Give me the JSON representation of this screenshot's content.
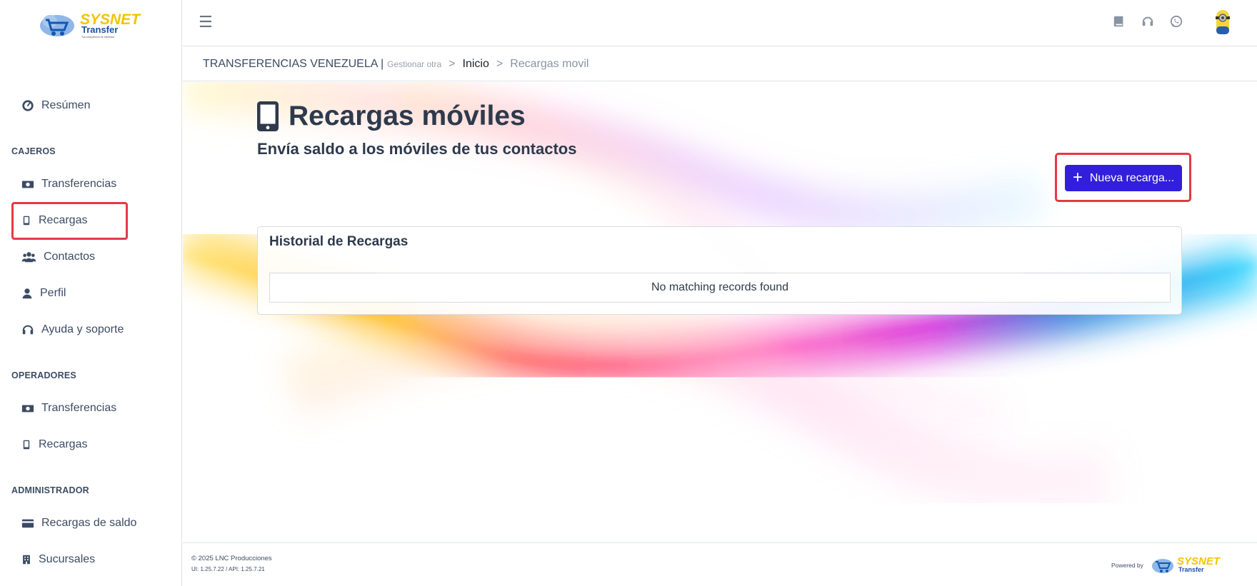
{
  "brand": {
    "logo_word": "SYSNET",
    "logo_sub": "Transfer",
    "logo_tagline": "Tus compañeros de bienestar"
  },
  "sidebar": {
    "top_item": "Resúmen",
    "sections": [
      {
        "title": "CAJEROS",
        "items": [
          "Transferencias",
          "Recargas",
          "Contactos",
          "Perfil",
          "Ayuda y soporte"
        ]
      },
      {
        "title": "OPERADORES",
        "items": [
          "Transferencias",
          "Recargas"
        ]
      },
      {
        "title": "ADMINISTRADOR",
        "items": [
          "Recargas de saldo",
          "Sucursales"
        ]
      }
    ]
  },
  "header": {
    "menu_icon": "hamburger-icon",
    "icons": [
      "book-icon",
      "headset-icon",
      "whatsapp-icon"
    ],
    "avatar": "minion-avatar"
  },
  "breadcrumb": {
    "org": "TRANSFERENCIAS VENEZUELA |",
    "manage": "Gestionar otra",
    "sep": ">",
    "home": "Inicio",
    "current": "Recargas movil"
  },
  "main": {
    "title": "Recargas móviles",
    "subtitle": "Envía saldo a los móviles de tus contactos",
    "new_button": "Nueva recarga...",
    "card_title": "Historial de Recargas",
    "empty_text": "No matching records found"
  },
  "footer": {
    "copyright": "© 2025 LNC Producciones",
    "version": "UI: 1.25.7.22 / API: 1.25.7.21",
    "powered": "Powered by"
  },
  "colors": {
    "primary": "#321fdb",
    "highlight": "#e53945",
    "text_dark": "#2e3a4c"
  }
}
